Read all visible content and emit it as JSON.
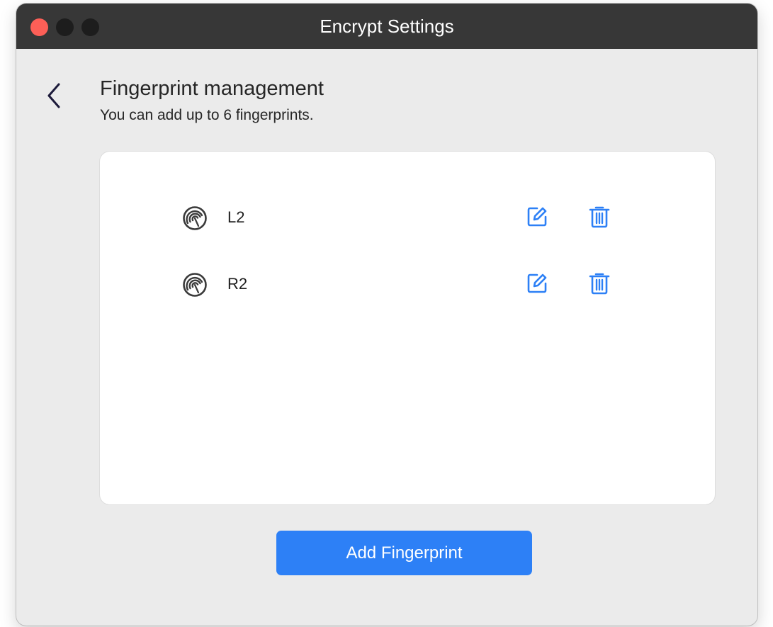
{
  "window": {
    "title": "Encrypt Settings"
  },
  "header": {
    "title": "Fingerprint management",
    "subtitle": "You can add up to 6 fingerprints."
  },
  "fingerprints": [
    {
      "name": "L2",
      "icon": "fingerprint-icon"
    },
    {
      "name": "R2",
      "icon": "fingerprint-icon"
    }
  ],
  "actions": {
    "add_label": "Add Fingerprint"
  },
  "colors": {
    "accent": "#2d80f6",
    "titlebar": "#373737",
    "close": "#fd5f57"
  }
}
